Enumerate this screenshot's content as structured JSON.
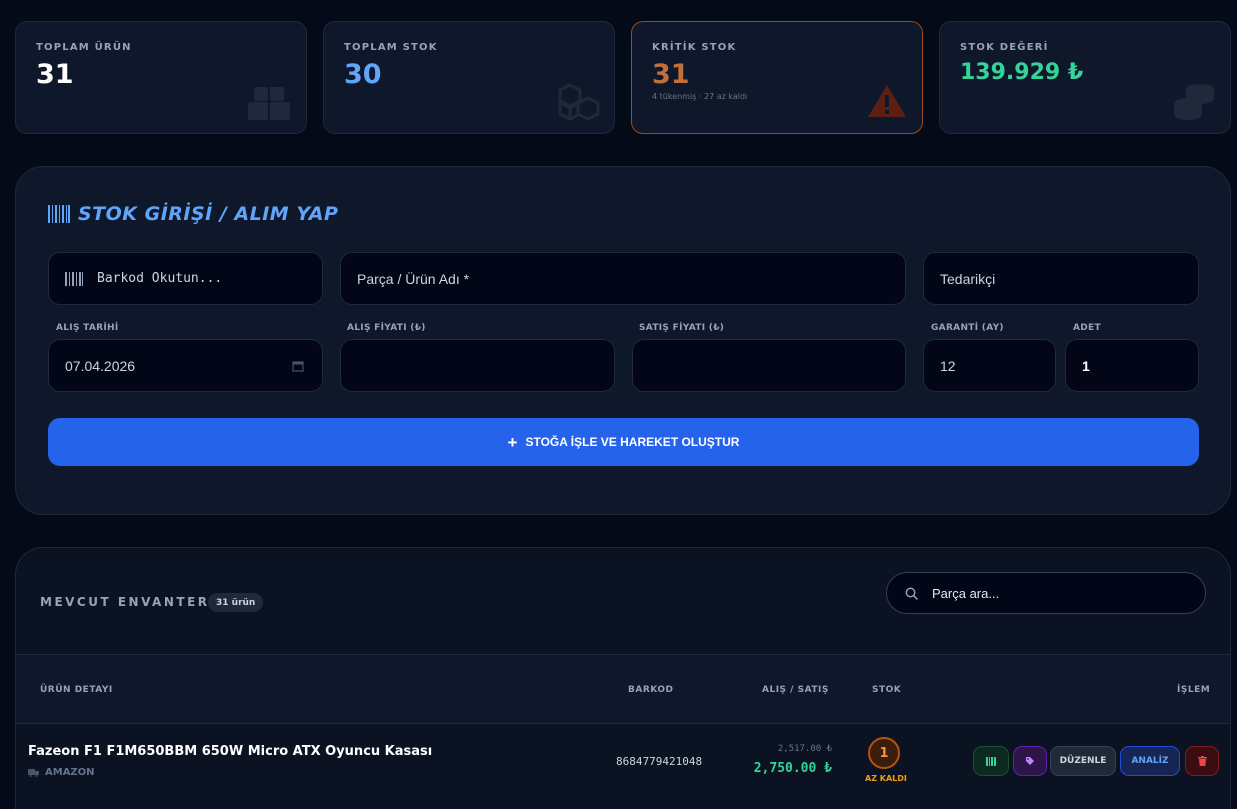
{
  "stats": [
    {
      "label": "TOPLAM ÜRÜN",
      "value": "31",
      "icon": "boxes-icon"
    },
    {
      "label": "TOPLAM STOK",
      "value": "30",
      "icon": "cubes-icon"
    },
    {
      "label": "KRİTİK STOK",
      "value": "31",
      "sub": "4 tükenmiş · 27 az kaldı",
      "icon": "warning-icon"
    },
    {
      "label": "STOK DEĞERİ",
      "value": "139.929 ₺",
      "icon": "coins-icon"
    }
  ],
  "entry": {
    "title": "STOK GİRİŞİ / ALIM YAP",
    "barcode_placeholder": "Barkod Okutun...",
    "product_placeholder": "Parça / Ürün Adı *",
    "supplier_placeholder": "Tedarikçi",
    "labels": {
      "date": "ALIŞ TARİHİ",
      "buy_price": "ALIŞ FİYATI (₺)",
      "sell_price": "SATIŞ FİYATI (₺)",
      "warranty": "GARANTİ (AY)",
      "quantity": "ADET"
    },
    "values": {
      "date": "07.04.2026",
      "warranty": "12",
      "quantity": "1"
    },
    "submit_label": "STOĞA İŞLE VE HAREKET OLUŞTUR"
  },
  "inventory": {
    "title": "MEVCUT ENVANTER",
    "count_badge": "31 ürün",
    "search_placeholder": "Parça ara...",
    "columns": {
      "detail": "ÜRÜN DETAYI",
      "barcode": "BARKOD",
      "price": "ALIŞ / SATIŞ",
      "stock": "STOK",
      "action": "İŞLEM"
    },
    "rows": [
      {
        "name": "Fazeon F1 F1M650BBM 650W Micro ATX Oyuncu Kasası",
        "supplier": "AMAZON",
        "barcode": "8684779421048",
        "buy": "2,517.00 ₺",
        "sell": "2,750.00 ₺",
        "stock": "1",
        "stock_note": "AZ KALDI",
        "actions": {
          "edit": "DÜZENLE",
          "analyze": "ANALİZ"
        }
      }
    ]
  },
  "colors": {
    "background": "#050a18",
    "accent_blue": "#2563eb",
    "stock_blue": "#60a5fa",
    "critical_orange": "#c2703a",
    "value_green": "#34d399"
  }
}
